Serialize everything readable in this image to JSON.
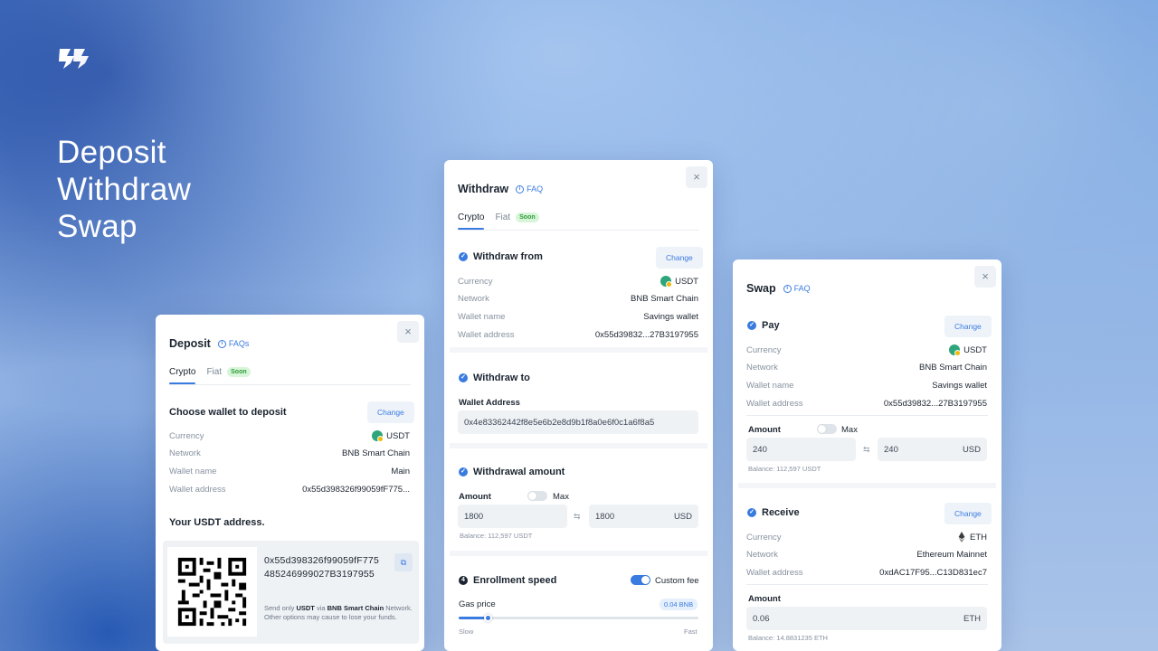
{
  "hero": {
    "line1": "Deposit",
    "line2": "Withdraw",
    "line3": "Swap"
  },
  "icons": {
    "logo": "brand-logo",
    "close": "close-icon",
    "info": "info-icon",
    "check": "check-icon",
    "copy": "copy-icon",
    "swap": "swap-arrows-icon"
  },
  "colors": {
    "accent": "#3a7be0",
    "soon_bg": "#d7f5d8",
    "soon_text": "#2f9a3a",
    "usdt": "#2ea57a"
  },
  "deposit": {
    "title": "Deposit",
    "faq": "FAQs",
    "close": "×",
    "tabs": {
      "crypto": "Crypto",
      "fiat": "Fiat",
      "soon": "Soon"
    },
    "section_title": "Choose wallet to deposit",
    "change": "Change",
    "rows": [
      {
        "k": "Currency",
        "v": "USDT"
      },
      {
        "k": "Network",
        "v": "BNB Smart Chain"
      },
      {
        "k": "Wallet name",
        "v": "Main"
      },
      {
        "k": "Wallet address",
        "v": "0x55d398326f99059fF775..."
      }
    ],
    "address_title": "Your USDT address.",
    "address_line1": "0x55d398326f99059fF775",
    "address_line2": "485246999027B3197955",
    "note_pre": "Send only ",
    "note_coin": "USDT",
    "note_mid": " via ",
    "note_net": "BNB Smart Chain",
    "note_post": " Network. Other options may cause to lose your funds."
  },
  "withdraw": {
    "title": "Withdraw",
    "faq": "FAQ",
    "close": "×",
    "tabs": {
      "crypto": "Crypto",
      "fiat": "Fiat",
      "soon": "Soon"
    },
    "from_title": "Withdraw from",
    "change": "Change",
    "rows": [
      {
        "k": "Currency",
        "v": "USDT"
      },
      {
        "k": "Network",
        "v": "BNB Smart Chain"
      },
      {
        "k": "Wallet name",
        "v": "Savings wallet"
      },
      {
        "k": "Wallet address",
        "v": "0x55d39832...27B3197955"
      }
    ],
    "to_title": "Withdraw to",
    "wallet_address_label": "Wallet Address",
    "wallet_address_value": "0x4e83362442f8e5e6b2e8d9b1f8a0e6f0c1a6f8a5",
    "amount_title": "Withdrawal amount",
    "amount_label": "Amount",
    "max_label": "Max",
    "amount_value": "1800",
    "amount_usd": "1800",
    "usd": "USD",
    "balance": "Balance: 112,597 USDT",
    "speed_num": "4",
    "speed_title": "Enrollment speed",
    "custom_fee": "Custom fee",
    "gas_label": "Gas price",
    "gas_value": "0.04 BNB",
    "gas_level": 0.12,
    "slow": "Slow",
    "fast": "Fast"
  },
  "swap": {
    "title": "Swap",
    "faq": "FAQ",
    "close": "×",
    "pay_title": "Pay",
    "change": "Change",
    "pay_rows": [
      {
        "k": "Currency",
        "v": "USDT"
      },
      {
        "k": "Network",
        "v": "BNB Smart Chain"
      },
      {
        "k": "Wallet name",
        "v": "Savings wallet"
      },
      {
        "k": "Wallet address",
        "v": "0x55d39832...27B3197955"
      }
    ],
    "amount_label": "Amount",
    "max_label": "Max",
    "pay_amount": "240",
    "pay_usd": "240",
    "usd": "USD",
    "pay_balance": "Balance: 112,597 USDT",
    "receive_title": "Receive",
    "receive_rows": [
      {
        "k": "Currency",
        "v": "ETH"
      },
      {
        "k": "Network",
        "v": "Ethereum Mainnet"
      },
      {
        "k": "Wallet address",
        "v": "0xdAC17F95...C13D831ec7"
      }
    ],
    "receive_amount_label": "Amount",
    "receive_amount": "0.06",
    "eth": "ETH",
    "receive_balance": "Balance: 14.8831235 ETH"
  }
}
